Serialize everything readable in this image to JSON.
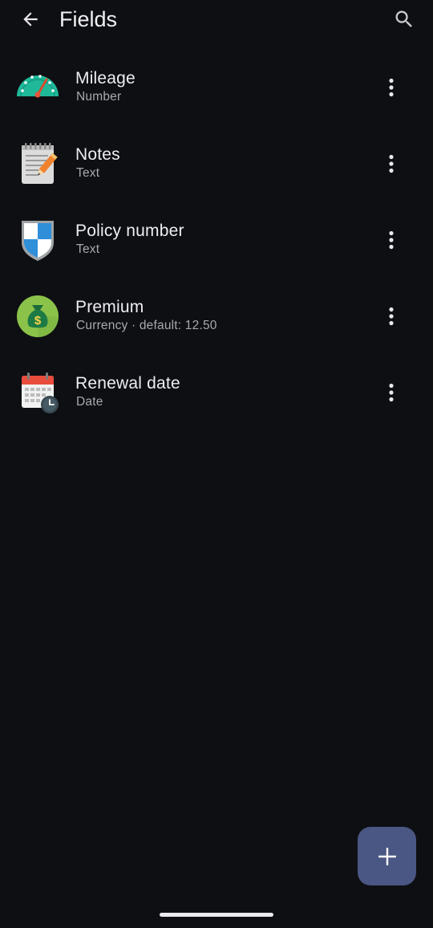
{
  "header": {
    "title": "Fields",
    "back_icon": "arrow-back-icon",
    "search_icon": "search-icon"
  },
  "fields": [
    {
      "name": "Mileage",
      "subtitle": "Number",
      "icon": "speedometer-icon"
    },
    {
      "name": "Notes",
      "subtitle": "Text",
      "icon": "notepad-icon"
    },
    {
      "name": "Policy number",
      "subtitle": "Text",
      "icon": "shield-icon"
    },
    {
      "name": "Premium",
      "subtitle": "Currency · default: 12.50",
      "icon": "money-bag-icon"
    },
    {
      "name": "Renewal date",
      "subtitle": "Date",
      "icon": "calendar-clock-icon"
    }
  ],
  "fab": {
    "icon": "plus-icon"
  },
  "colors": {
    "background": "#0e0f13",
    "fab": "#4a5683",
    "text_secondary": "#a8a9b0"
  }
}
